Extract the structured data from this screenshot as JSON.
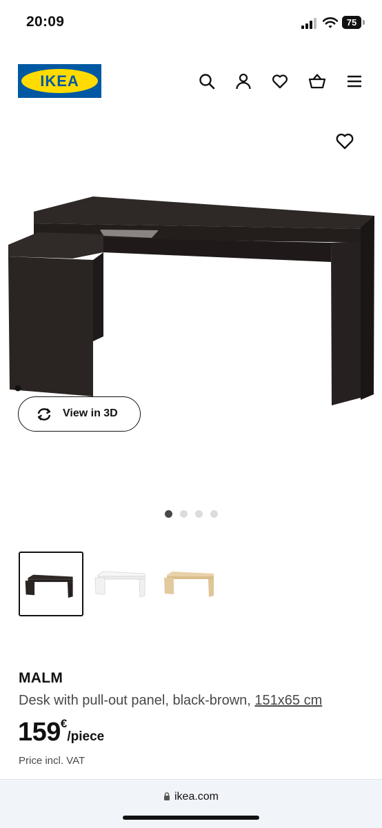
{
  "status_bar": {
    "time": "20:09",
    "battery": "75",
    "icons": [
      "cellular-signal-icon",
      "wifi-icon",
      "battery-icon"
    ]
  },
  "header": {
    "logo_text": "IKEA",
    "icons": [
      "search-icon",
      "user-icon",
      "heart-icon",
      "shopping-basket-icon",
      "hamburger-menu-icon"
    ]
  },
  "product_image": {
    "favourite_icon": "heart-icon",
    "view_3d_label": "View in 3D",
    "view_3d_icon": "rotate-arrows-icon",
    "carousel": {
      "total": 4,
      "active_index": 0
    }
  },
  "variants": [
    {
      "name": "black-brown",
      "color": "#2b2523",
      "selected": true
    },
    {
      "name": "white",
      "color": "#f4f4f4",
      "selected": false
    },
    {
      "name": "oak veneer",
      "color": "#e3c99e",
      "selected": false
    }
  ],
  "product": {
    "name": "MALM",
    "description": "Desk with pull-out panel, black-brown,",
    "size": "151x65 cm",
    "price": "159",
    "currency": "€",
    "unit": "/piece",
    "vat_note": "Price incl. VAT"
  },
  "browser": {
    "url": "ikea.com"
  },
  "colors": {
    "ikea_blue": "#0058a3",
    "ikea_yellow": "#ffdb00",
    "text_primary": "#111111",
    "text_secondary": "#484848"
  }
}
